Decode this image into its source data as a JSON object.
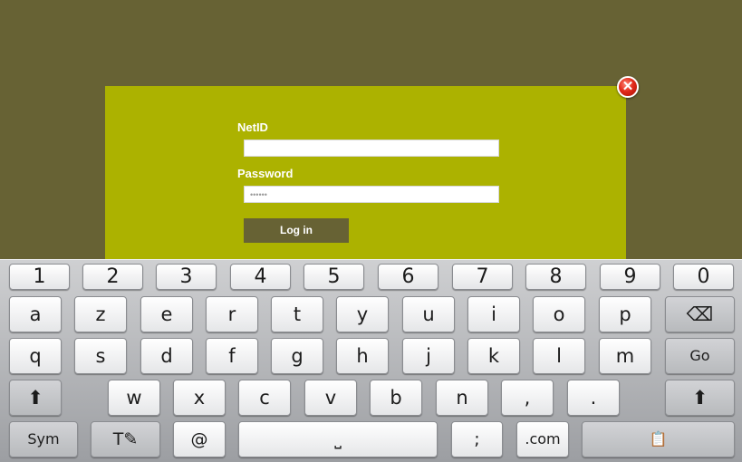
{
  "dialog": {
    "close_glyph": "✕",
    "netid_label": "NetID",
    "netid_value": "",
    "password_label": "Password",
    "password_value": "••••••",
    "login_label": "Log in",
    "bg_color": "#acb200",
    "page_bg": "#676234"
  },
  "keyboard": {
    "numbers": [
      "1",
      "2",
      "3",
      "4",
      "5",
      "6",
      "7",
      "8",
      "9",
      "0"
    ],
    "row1": [
      "a",
      "z",
      "e",
      "r",
      "t",
      "y",
      "u",
      "i",
      "o",
      "p"
    ],
    "row1_special": "⌫",
    "row2": [
      "q",
      "s",
      "d",
      "f",
      "g",
      "h",
      "j",
      "k",
      "l",
      "m"
    ],
    "row2_special": "Go",
    "row3": [
      "w",
      "x",
      "c",
      "v",
      "b",
      "n"
    ],
    "row3_punct1": ",",
    "row3_punct2": ".",
    "shift_glyph": "⬆",
    "sym_label": "Sym",
    "handwriting_label": "T✎",
    "at_label": "@",
    "space_glyph": "⎵",
    "semicolon_label": ";",
    "dotcom_label": ".com",
    "clipboard_glyph": "📋"
  }
}
